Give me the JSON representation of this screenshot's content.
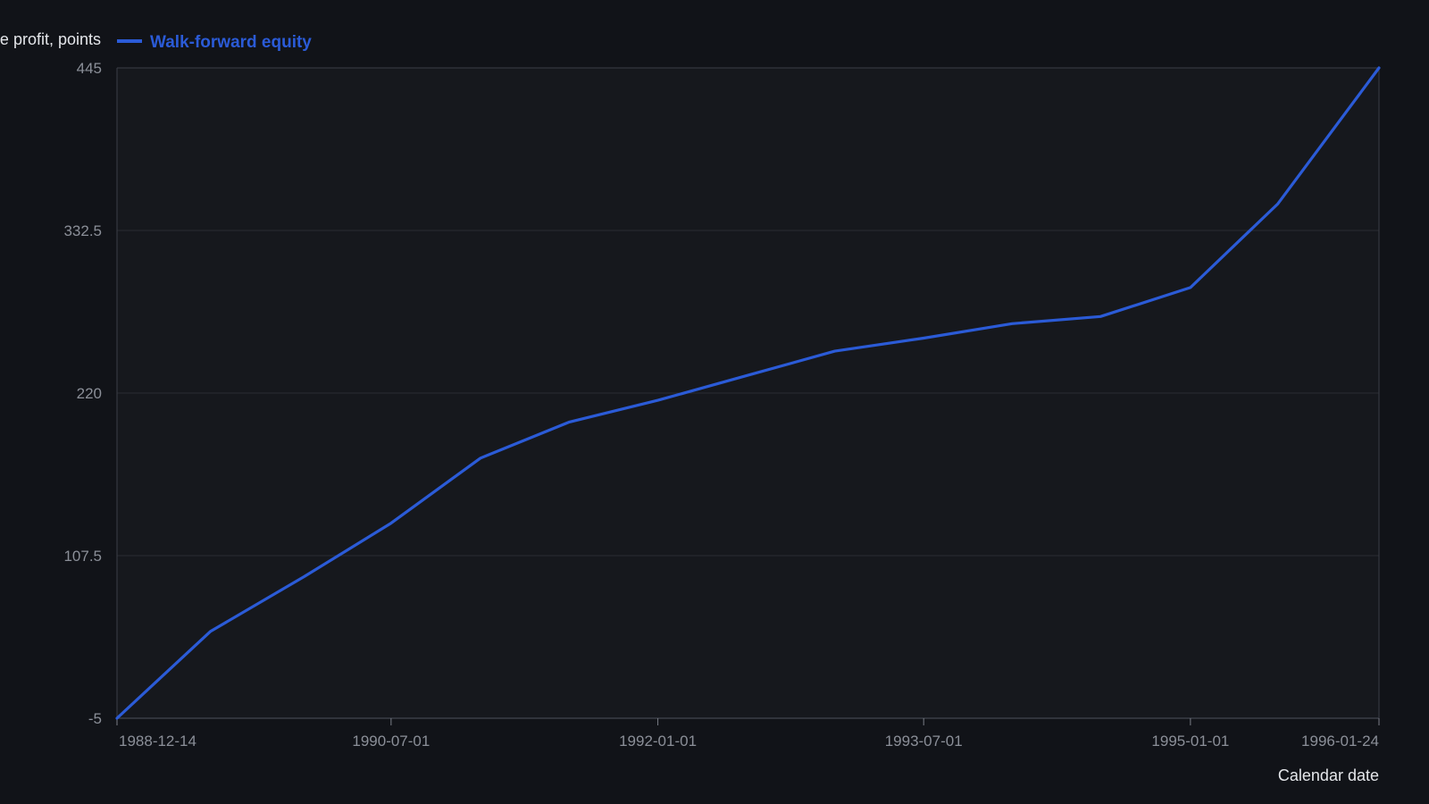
{
  "chart_data": {
    "type": "line",
    "xlabel": "Calendar date",
    "ylabel": "Cumulative profit, points",
    "x_axis_type": "date",
    "x_ticks": [
      "1988-12-14",
      "1990-07-01",
      "1992-01-01",
      "1993-07-01",
      "1995-01-01",
      "1996-01-24"
    ],
    "y_ticks": [
      -5,
      107.5,
      220,
      332.5,
      445
    ],
    "ylim": [
      -5,
      445
    ],
    "xlim": [
      "1988-12-14",
      "1996-01-24"
    ],
    "grid": "horizontal",
    "legend_position": "top-left",
    "series": [
      {
        "name": "Walk-forward equity",
        "color": "#2b5bd7",
        "points": [
          {
            "x": "1988-12-14",
            "y": -5
          },
          {
            "x": "1989-06-24",
            "y": 55
          },
          {
            "x": "1990-01-03",
            "y": 93
          },
          {
            "x": "1990-07-01",
            "y": 130
          },
          {
            "x": "1991-01-01",
            "y": 175
          },
          {
            "x": "1991-07-03",
            "y": 200
          },
          {
            "x": "1992-01-01",
            "y": 215
          },
          {
            "x": "1992-07-01",
            "y": 232
          },
          {
            "x": "1992-12-30",
            "y": 249
          },
          {
            "x": "1993-07-01",
            "y": 258
          },
          {
            "x": "1993-12-30",
            "y": 268
          },
          {
            "x": "1994-06-30",
            "y": 273
          },
          {
            "x": "1995-01-01",
            "y": 293
          },
          {
            "x": "1995-06-30",
            "y": 351
          },
          {
            "x": "1996-01-24",
            "y": 445
          }
        ]
      }
    ]
  },
  "colors": {
    "background": "#111318",
    "plot_background": "#16181d",
    "grid": "#2a2d34",
    "axis": "#3a3e46"
  }
}
